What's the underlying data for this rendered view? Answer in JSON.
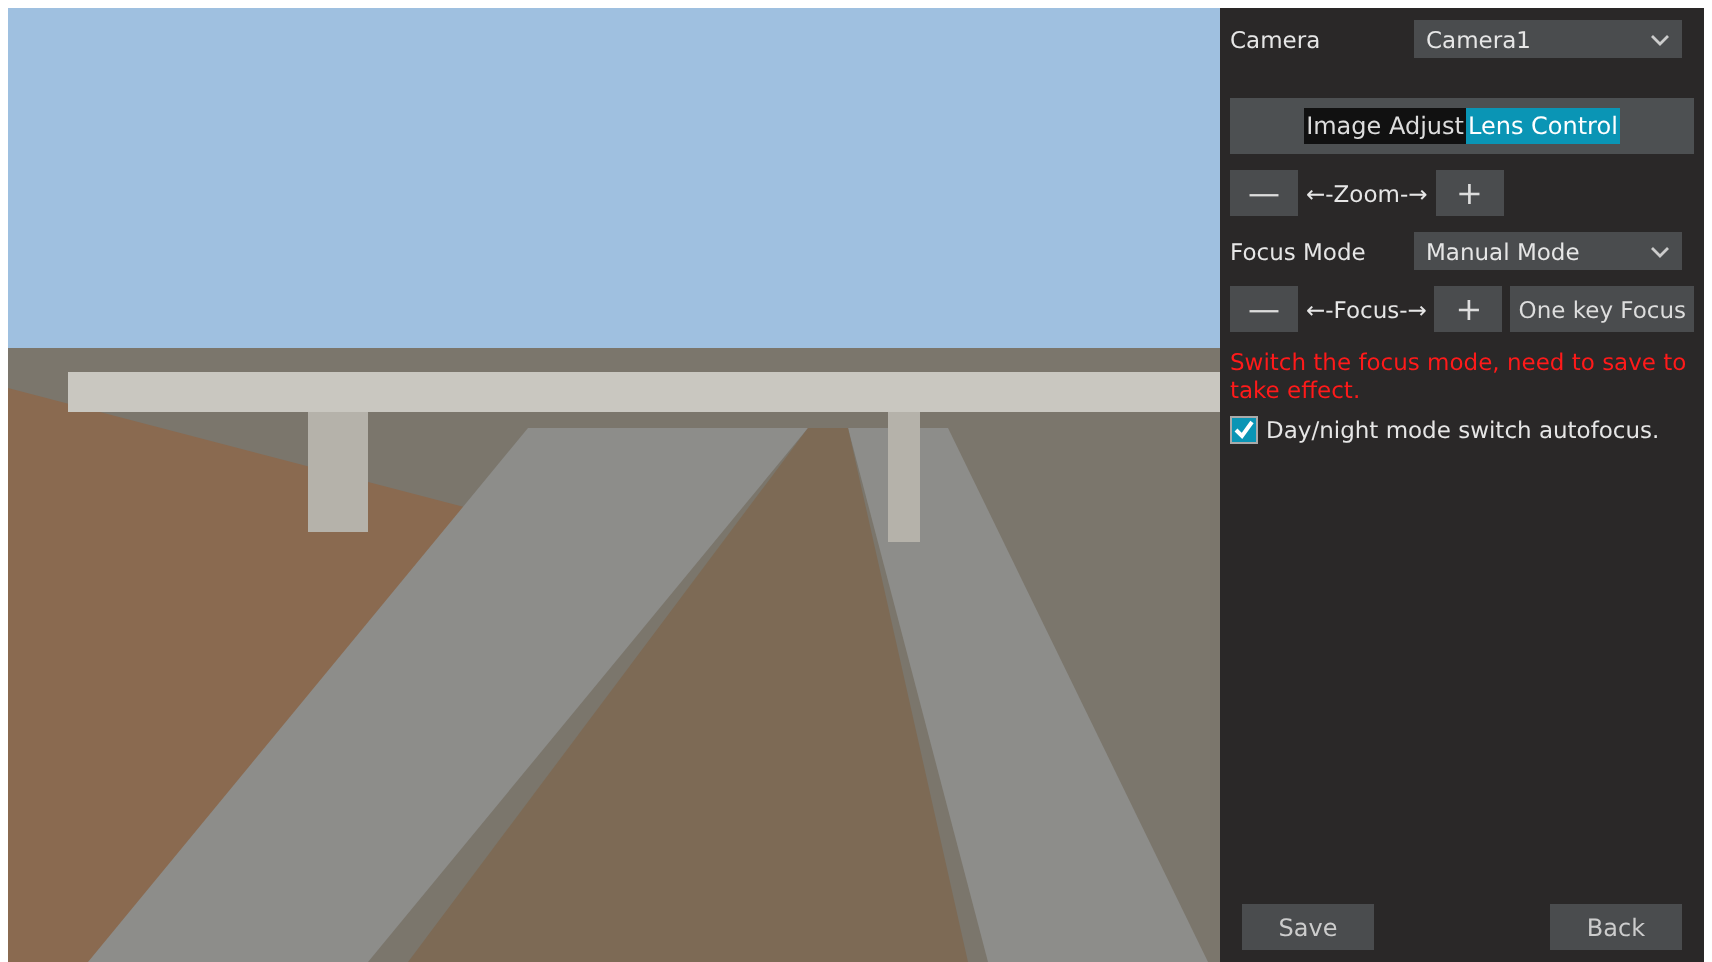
{
  "camera": {
    "label": "Camera",
    "value": "Camera1"
  },
  "tabs": [
    {
      "label": "Image Adjust",
      "selected": false
    },
    {
      "label": "Lens Control",
      "selected": true
    }
  ],
  "zoom": {
    "minus": "—",
    "label": "←-Zoom-→",
    "plus": "+"
  },
  "focus_mode": {
    "label": "Focus Mode",
    "value": "Manual Mode"
  },
  "focus": {
    "minus": "—",
    "label": "←-Focus-→",
    "plus": "+",
    "one_key": "One key Focus"
  },
  "warning": "Switch the focus mode, need to save to take effect.",
  "autofocus": {
    "label": "Day/night mode switch autofocus.",
    "checked": true
  },
  "buttons": [
    "Save",
    "Back"
  ]
}
